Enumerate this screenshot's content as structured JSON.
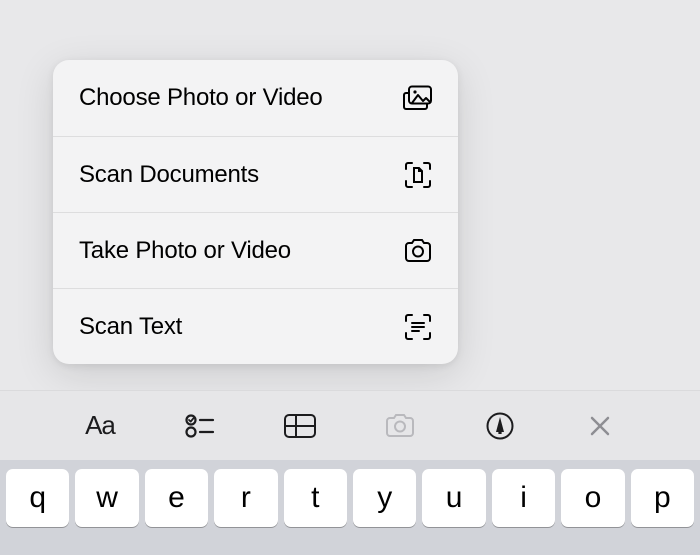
{
  "menu": {
    "items": [
      {
        "label": "Choose Photo or Video",
        "icon": "gallery-icon"
      },
      {
        "label": "Scan Documents",
        "icon": "scan-document-icon"
      },
      {
        "label": "Take Photo or Video",
        "icon": "camera-icon"
      },
      {
        "label": "Scan Text",
        "icon": "scan-text-icon"
      }
    ]
  },
  "toolbar": {
    "format_label": "Aa",
    "items": [
      "format",
      "checklist",
      "table",
      "camera",
      "markup",
      "close"
    ]
  },
  "keyboard": {
    "row": [
      "q",
      "w",
      "e",
      "r",
      "t",
      "y",
      "u",
      "i",
      "o",
      "p"
    ]
  }
}
